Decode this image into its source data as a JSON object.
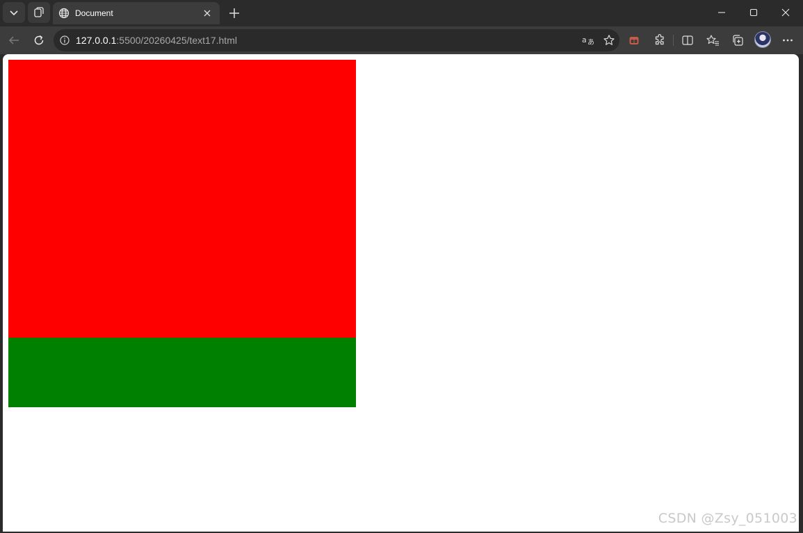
{
  "tab": {
    "title": "Document"
  },
  "address": {
    "host": "127.0.0.1",
    "rest": ":5500/20260425/text17.html"
  },
  "page": {
    "boxes": [
      {
        "color": "#ff0000"
      },
      {
        "color": "#008000"
      }
    ],
    "watermark": "CSDN @Zsy_051003"
  },
  "icons": {
    "tab_actions": "chevron-down-icon",
    "workspaces": "workspaces-icon",
    "tab_favicon": "globe-icon",
    "tab_close": "close-icon",
    "new_tab": "plus-icon",
    "minimize": "minimize-icon",
    "maximize": "maximize-icon",
    "close_window": "close-icon",
    "back": "back-arrow-icon",
    "refresh": "refresh-icon",
    "site_info": "info-icon",
    "translate": "translate-icon",
    "favorite": "star-icon",
    "extension_red": "extension-icon",
    "extensions": "puzzle-icon",
    "split_screen": "split-screen-icon",
    "favorites": "favorites-icon",
    "collections": "collections-icon",
    "profile": "avatar",
    "more": "more-icon"
  }
}
